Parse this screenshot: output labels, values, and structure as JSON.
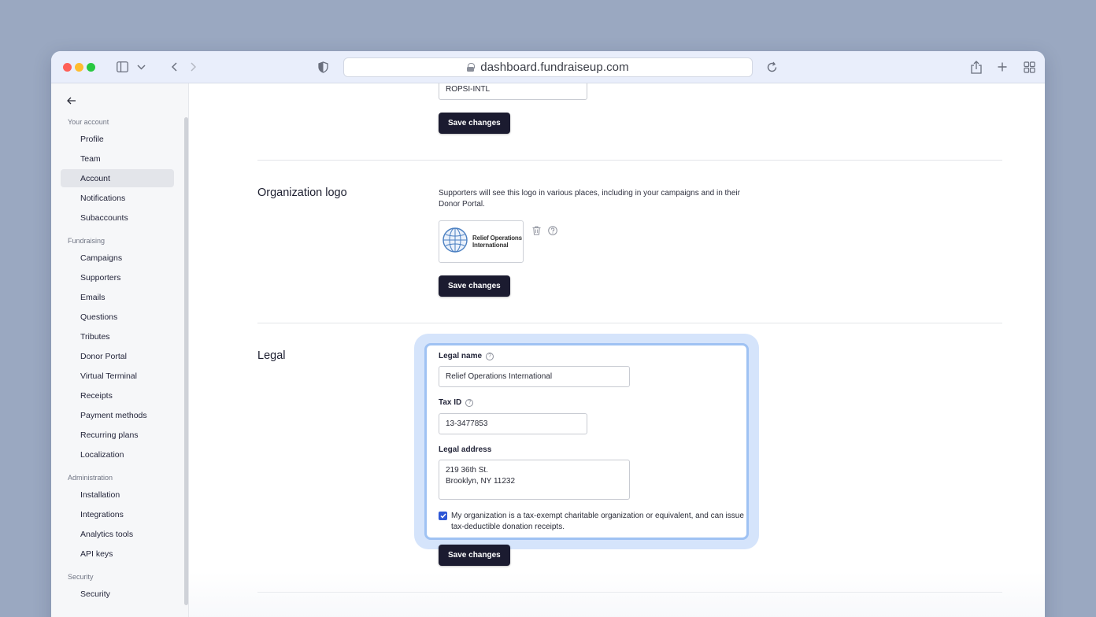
{
  "browser": {
    "url": "dashboard.fundraiseup.com"
  },
  "sidebar": {
    "groups": [
      {
        "label": "Your account",
        "items": [
          "Profile",
          "Team",
          "Account",
          "Notifications",
          "Subaccounts"
        ]
      },
      {
        "label": "Fundraising",
        "items": [
          "Campaigns",
          "Supporters",
          "Emails",
          "Questions",
          "Tributes",
          "Donor Portal",
          "Virtual Terminal",
          "Receipts",
          "Payment methods",
          "Recurring plans",
          "Localization"
        ]
      },
      {
        "label": "Administration",
        "items": [
          "Installation",
          "Integrations",
          "Analytics tools",
          "API keys"
        ]
      },
      {
        "label": "Security",
        "items": [
          "Security"
        ]
      }
    ],
    "active_item": "Account"
  },
  "top_section": {
    "field_value": "ROPSI-INTL",
    "save_label": "Save changes"
  },
  "logo_section": {
    "title": "Organization logo",
    "description": "Supporters will see this logo in various places, including in your campaigns and in their Donor Portal.",
    "logo_text": "Relief Operations International",
    "save_label": "Save changes"
  },
  "legal_section": {
    "title": "Legal",
    "legal_name_label": "Legal name",
    "legal_name_value": "Relief Operations International",
    "tax_id_label": "Tax ID",
    "tax_id_value": "13-3477853",
    "address_label": "Legal address",
    "address_value": "219 36th St.\nBrooklyn, NY 11232",
    "tax_exempt_checked": true,
    "tax_exempt_text": "My organization is a tax-exempt charitable organization or equivalent, and can issue tax-deductible donation receipts.",
    "save_label": "Save changes"
  },
  "colors": {
    "primary_button": "#1b1b30",
    "focus_ring": "#d5e4fb",
    "checkbox": "#2e57d6",
    "background": "#9aa8c1"
  }
}
